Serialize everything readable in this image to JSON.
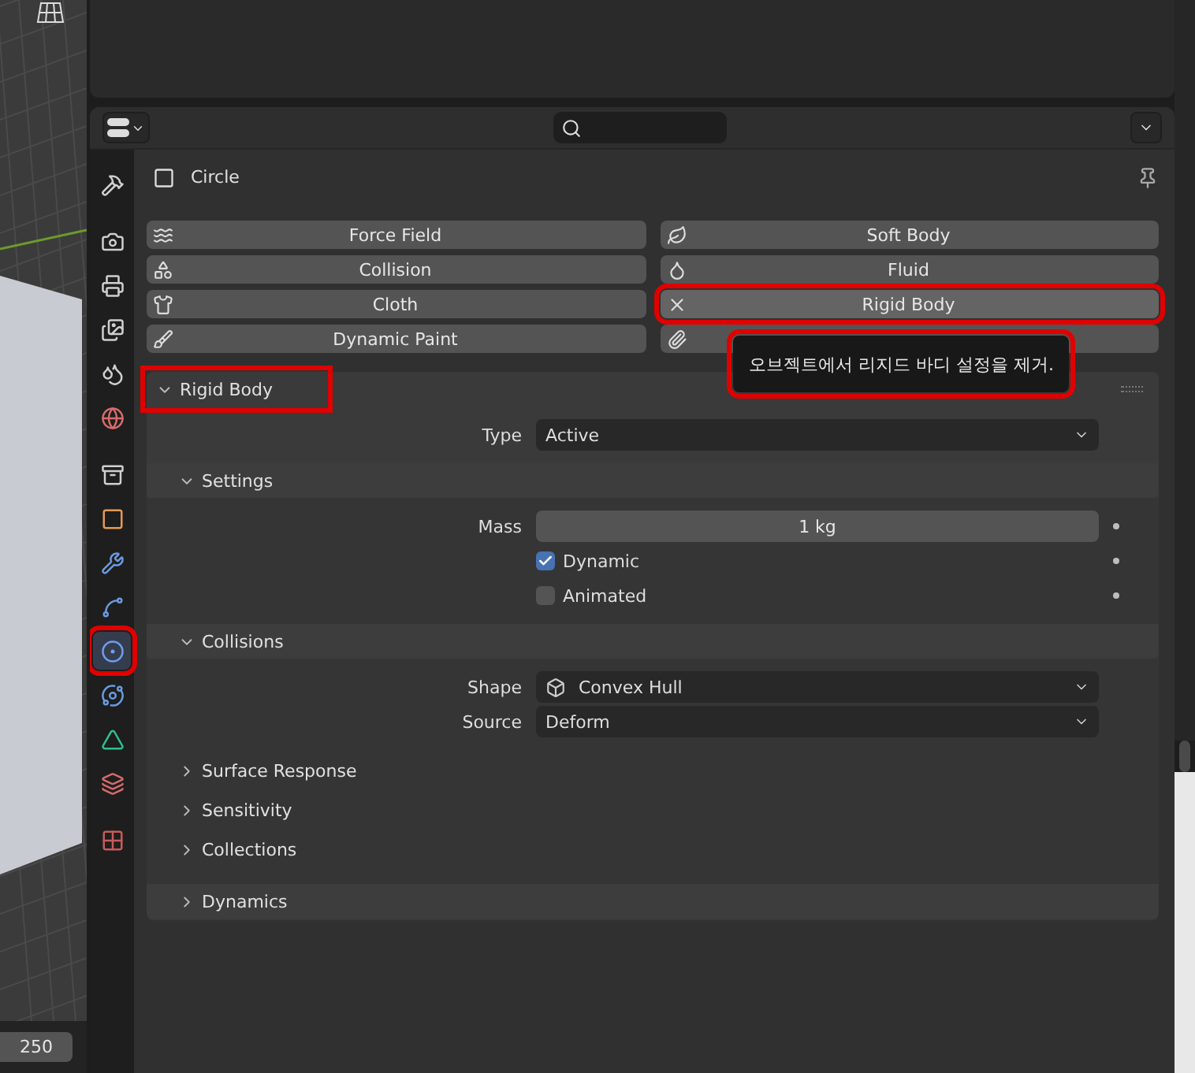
{
  "viewport": {
    "frame_field": "250"
  },
  "tabs": [
    {
      "selected": false,
      "highlighted": false
    },
    {
      "selected": false,
      "highlighted": false
    },
    {
      "selected": false,
      "highlighted": false
    },
    {
      "selected": false,
      "highlighted": false
    },
    {
      "selected": false,
      "highlighted": false
    },
    {
      "selected": false,
      "highlighted": false
    },
    {
      "selected": false,
      "highlighted": false
    },
    {
      "selected": false,
      "highlighted": false
    },
    {
      "selected": false,
      "highlighted": false
    },
    {
      "selected": false,
      "highlighted": false
    },
    {
      "selected": true,
      "highlighted": true
    },
    {
      "selected": false,
      "highlighted": false
    },
    {
      "selected": false,
      "highlighted": false
    },
    {
      "selected": false,
      "highlighted": false
    },
    {
      "selected": false,
      "highlighted": false
    }
  ],
  "object": {
    "name": "Circle"
  },
  "physics_buttons": [
    {
      "label": "Force Field",
      "enabled": false,
      "highlighted": false
    },
    {
      "label": "Soft Body",
      "enabled": false,
      "highlighted": false
    },
    {
      "label": "Collision",
      "enabled": false,
      "highlighted": false
    },
    {
      "label": "Fluid",
      "enabled": false,
      "highlighted": false
    },
    {
      "label": "Cloth",
      "enabled": false,
      "highlighted": false
    },
    {
      "label": "Rigid Body",
      "enabled": true,
      "highlighted": true
    },
    {
      "label": "Dynamic Paint",
      "enabled": false,
      "highlighted": false
    },
    {
      "enabled": false,
      "highlighted": false
    }
  ],
  "tooltip": {
    "text": "오브젝트에서 리지드 바디 설정을 제거.",
    "highlighted": true
  },
  "panel": {
    "title": "Rigid Body",
    "expanded": true,
    "highlighted": true,
    "rows": [
      {
        "kind": "dropdown",
        "label": "Type",
        "value": "Active",
        "animatable": false
      }
    ],
    "subpanels": [
      {
        "title": "Settings",
        "expanded": true,
        "rows": [
          {
            "kind": "number",
            "label": "Mass",
            "value": "1 kg",
            "animatable": true
          },
          {
            "kind": "checkbox",
            "label": "Dynamic",
            "checked": true,
            "animatable": true
          },
          {
            "kind": "checkbox",
            "label": "Animated",
            "checked": false,
            "animatable": true
          }
        ]
      },
      {
        "title": "Collisions",
        "expanded": true,
        "rows": [
          {
            "kind": "icon_dropdown",
            "label": "Shape",
            "value": "Convex Hull",
            "animatable": false
          },
          {
            "kind": "dropdown",
            "label": "Source",
            "value": "Deform",
            "animatable": false
          }
        ],
        "children": [
          {
            "title": "Surface Response",
            "expanded": false
          },
          {
            "title": "Sensitivity",
            "expanded": false
          },
          {
            "title": "Collections",
            "expanded": false
          }
        ]
      },
      {
        "title": "Dynamics",
        "expanded": false
      }
    ]
  }
}
